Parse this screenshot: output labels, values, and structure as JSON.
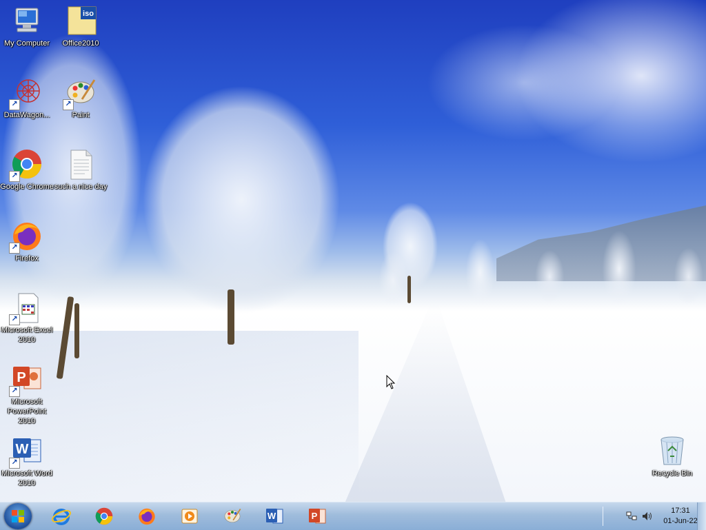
{
  "desktop": {
    "icons": [
      {
        "name": "My Computer",
        "icon": "computer-icon"
      },
      {
        "name": "Office2010",
        "icon": "iso-icon",
        "badge": "iso"
      },
      {
        "name": "DataWagon...",
        "icon": "datawagon-icon"
      },
      {
        "name": "Paint",
        "icon": "paint-icon"
      },
      {
        "name": "Google Chrome",
        "icon": "chrome-icon"
      },
      {
        "name": "such a nice day",
        "icon": "text-file-icon"
      },
      {
        "name": "Firefox",
        "icon": "firefox-icon"
      },
      {
        "name": "Microsoft Excel 2010",
        "icon": "excel-icon"
      },
      {
        "name": "Microsoft PowerPoint 2010",
        "icon": "powerpoint-icon"
      },
      {
        "name": "Microsoft Word 2010",
        "icon": "word-icon"
      },
      {
        "name": "Recycle Bin",
        "icon": "recycle-bin-icon"
      }
    ]
  },
  "taskbar": {
    "start": {
      "icon": "windows-start-icon"
    },
    "pinned": [
      {
        "name": "Internet Explorer",
        "icon": "internet-explorer-icon"
      },
      {
        "name": "Google Chrome",
        "icon": "chrome-icon"
      },
      {
        "name": "Firefox",
        "icon": "firefox-icon"
      },
      {
        "name": "Media Player",
        "icon": "media-player-icon"
      },
      {
        "name": "Paint",
        "icon": "paint-icon"
      },
      {
        "name": "Microsoft Word",
        "icon": "word-icon",
        "letter": "W"
      },
      {
        "name": "Microsoft PowerPoint",
        "icon": "powerpoint-icon",
        "letter": "P"
      }
    ],
    "tray": {
      "network_icon": "network-icon",
      "volume_icon": "volume-icon",
      "time": "17:31",
      "date": "01-Jun-22"
    }
  },
  "colors": {
    "taskbar": "#9fbcdc",
    "sky": "#2f5fd8",
    "snow": "#f3f6fb"
  }
}
